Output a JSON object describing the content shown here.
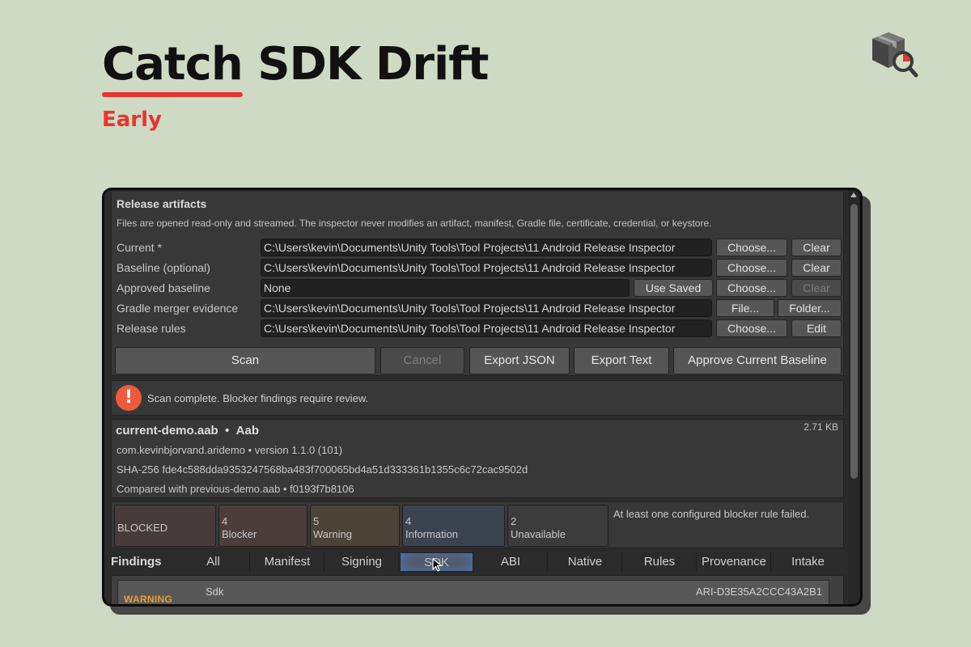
{
  "hero": {
    "title_part1": "Catch",
    "title_part2": "SDK Drift",
    "subtitle": "Early"
  },
  "logo": {
    "icon": "package-search-icon",
    "colors": {
      "box": "#555555",
      "accent": "#e8332f"
    }
  },
  "artifacts": {
    "title": "Release artifacts",
    "note": "Files are opened read-only and streamed. The inspector never modifies an artifact, manifest, Gradle file, certificate, credential, or keystore.",
    "rows": [
      {
        "label": "Current *",
        "value": "C:\\Users\\kevin\\Documents\\Unity Tools\\Tool Projects\\11 Android Release Inspector",
        "buttons": [
          "Choose...",
          "Clear"
        ]
      },
      {
        "label": "Baseline (optional)",
        "value": "C:\\Users\\kevin\\Documents\\Unity Tools\\Tool Projects\\11 Android Release Inspector",
        "buttons": [
          "Choose...",
          "Clear"
        ]
      },
      {
        "label": "Approved baseline",
        "value": "None",
        "buttons": [
          "Use Saved",
          "Choose...",
          "Clear"
        ]
      },
      {
        "label": "Gradle merger evidence",
        "value": "C:\\Users\\kevin\\Documents\\Unity Tools\\Tool Projects\\11 Android Release Inspector",
        "buttons": [
          "File...",
          "Folder..."
        ]
      },
      {
        "label": "Release rules",
        "value": "C:\\Users\\kevin\\Documents\\Unity Tools\\Tool Projects\\11 Android Release Inspector",
        "buttons": [
          "Choose...",
          "Edit"
        ]
      }
    ],
    "actions": {
      "scan": "Scan",
      "cancel": "Cancel",
      "export_json": "Export JSON",
      "export_text": "Export Text",
      "approve": "Approve Current Baseline"
    }
  },
  "status": {
    "icon": "alert-icon",
    "glyph": "!",
    "message": "Scan complete. Blocker findings require review."
  },
  "artifact_info": {
    "name": "current-demo.aab",
    "sep": "•",
    "format": "Aab",
    "size": "2.71 KB",
    "package_line": "com.kevinbjorvand.aridemo  •  version 1.1.0 (101)",
    "sha_line": "SHA-256  fde4c588dda9353247568ba483f700065bd4a51d333361b1355c6c72cac9502d",
    "compare_line": "Compared with previous-demo.aab  •  f0193f7b8106"
  },
  "summary": {
    "verdict": "BLOCKED",
    "cards": [
      {
        "count": "4",
        "label": "Blocker"
      },
      {
        "count": "5",
        "label": "Warning"
      },
      {
        "count": "4",
        "label": "Information"
      },
      {
        "count": "2",
        "label": "Unavailable"
      }
    ],
    "note": "At least one configured blocker rule failed.",
    "colors": {
      "blocked": "#473b3b",
      "blocker": "#4a3d3a",
      "warning": "#4a4337",
      "information": "#3a4350",
      "unavailable": "#3c3c3c"
    }
  },
  "findings": {
    "label": "Findings",
    "tabs": [
      "All",
      "Manifest",
      "Signing",
      "SDK",
      "ABI",
      "Native",
      "Rules",
      "Provenance",
      "Intake"
    ],
    "active_tab": "SDK",
    "rows": [
      {
        "severity": "WARNING",
        "category": "Sdk",
        "id": "ARI-D3E35A2CCC43A2B1"
      }
    ]
  }
}
